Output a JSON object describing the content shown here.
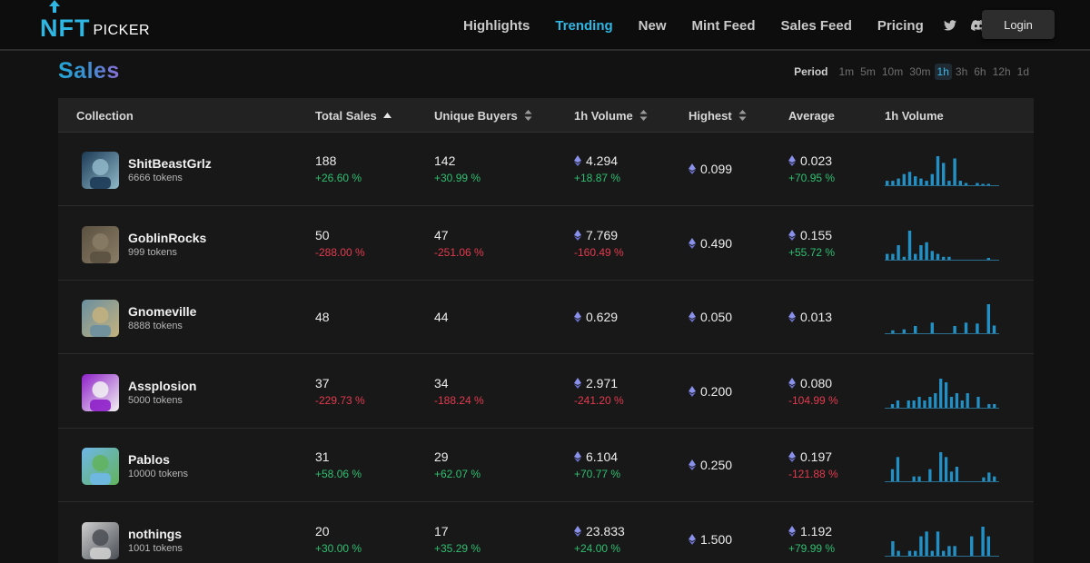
{
  "nav": {
    "logo_main": "NFT",
    "logo_sub": "PICKER",
    "items": [
      {
        "label": "Highlights",
        "active": false
      },
      {
        "label": "Trending",
        "active": true
      },
      {
        "label": "New",
        "active": false
      },
      {
        "label": "Mint Feed",
        "active": false
      },
      {
        "label": "Sales Feed",
        "active": false
      },
      {
        "label": "Pricing",
        "active": false
      }
    ],
    "icons": [
      "twitter-icon",
      "discord-icon"
    ],
    "login_label": "Login"
  },
  "page": {
    "title": "Sales",
    "period_label": "Period",
    "periods": [
      "1m",
      "5m",
      "10m",
      "30m",
      "1h",
      "3h",
      "6h",
      "12h",
      "1d"
    ],
    "active_period": "1h"
  },
  "table": {
    "columns": [
      "Collection",
      "Total Sales",
      "Unique Buyers",
      "1h Volume",
      "Highest",
      "Average",
      "1h Volume"
    ],
    "rows": [
      {
        "name": "ShitBeastGrlz",
        "tokens": "6666 tokens",
        "sales": "188",
        "sales_pct": "+26.60 %",
        "buyers": "142",
        "buyers_pct": "+30.99 %",
        "volume": "4.294",
        "volume_pct": "+18.87 %",
        "highest": "0.099",
        "average": "0.023",
        "average_pct": "+70.95 %",
        "spark": [
          2,
          2,
          3,
          5,
          6,
          4,
          3,
          2,
          5,
          13,
          10,
          2,
          12,
          2,
          1,
          0,
          1,
          0.6,
          0.6,
          0
        ],
        "avatar_colors": [
          "#1c3a55",
          "#8fb9c9"
        ]
      },
      {
        "name": "GoblinRocks",
        "tokens": "999 tokens",
        "sales": "50",
        "sales_pct": "-288.00 %",
        "buyers": "47",
        "buyers_pct": "-251.06 %",
        "volume": "7.769",
        "volume_pct": "-160.49 %",
        "highest": "0.490",
        "average": "0.155",
        "average_pct": "+55.72 %",
        "spark": [
          2,
          2,
          5,
          1,
          10,
          2,
          5,
          6,
          3,
          2,
          1,
          1,
          0,
          0,
          0,
          0,
          0,
          0,
          0.6,
          0
        ],
        "avatar_colors": [
          "#5b5140",
          "#8a7d66"
        ]
      },
      {
        "name": "Gnomeville",
        "tokens": "8888 tokens",
        "sales": "48",
        "sales_pct": "",
        "buyers": "44",
        "buyers_pct": "",
        "volume": "0.629",
        "volume_pct": "",
        "highest": "0.050",
        "average": "0.013",
        "average_pct": "",
        "spark": [
          0,
          0.6,
          0,
          0.8,
          0,
          1.5,
          0,
          0,
          2.2,
          0,
          0,
          0,
          1.5,
          0,
          2.2,
          0,
          2,
          0,
          6,
          1.6
        ],
        "avatar_colors": [
          "#6a8fa0",
          "#c4b27e"
        ]
      },
      {
        "name": "Assplosion",
        "tokens": "5000 tokens",
        "sales": "37",
        "sales_pct": "-229.73 %",
        "buyers": "34",
        "buyers_pct": "-188.24 %",
        "volume": "2.971",
        "volume_pct": "-241.20 %",
        "highest": "0.200",
        "average": "0.080",
        "average_pct": "-104.99 %",
        "spark": [
          0,
          1,
          2,
          0,
          2,
          2,
          3,
          2,
          3,
          4,
          8,
          7,
          3,
          4,
          2,
          4,
          0,
          3,
          0,
          1,
          1
        ],
        "avatar_colors": [
          "#8e1fc9",
          "#f2f2f2"
        ]
      },
      {
        "name": "Pablos",
        "tokens": "10000 tokens",
        "sales": "31",
        "sales_pct": "+58.06 %",
        "buyers": "29",
        "buyers_pct": "+62.07 %",
        "volume": "6.104",
        "volume_pct": "+70.77 %",
        "highest": "0.250",
        "average": "0.197",
        "average_pct": "-121.88 %",
        "spark": [
          0,
          2.5,
          5,
          0,
          0,
          1,
          1,
          0,
          2.5,
          0,
          6,
          5,
          2,
          3,
          0,
          0,
          0,
          0,
          0.8,
          1.8,
          1
        ],
        "avatar_colors": [
          "#6fb7e8",
          "#62b35c"
        ]
      },
      {
        "name": "nothings",
        "tokens": "1001 tokens",
        "sales": "20",
        "sales_pct": "+30.00 %",
        "buyers": "17",
        "buyers_pct": "+35.29 %",
        "volume": "23.833",
        "volume_pct": "+24.00 %",
        "highest": "1.500",
        "average": "1.192",
        "average_pct": "+79.99 %",
        "spark": [
          0,
          3,
          1,
          0,
          1,
          1,
          4,
          5,
          1,
          5,
          1,
          2,
          2,
          0,
          0,
          4,
          0,
          6,
          4,
          0
        ],
        "avatar_colors": [
          "#cfcfcf",
          "#4a4f55"
        ]
      }
    ]
  },
  "colors": {
    "accent": "#2fb6e3",
    "positive": "#2fbf71",
    "negative": "#e23b4e",
    "bar": "#2290c4",
    "eth": "#7b83e3"
  }
}
